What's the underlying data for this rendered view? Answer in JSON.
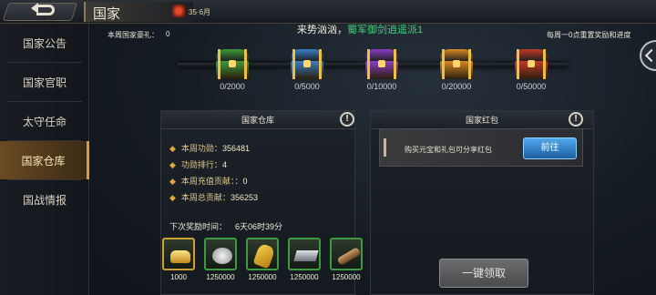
{
  "header": {
    "title": "国家",
    "player_level": "35·6月"
  },
  "sidebar": {
    "items": [
      {
        "label": "国家公告"
      },
      {
        "label": "国家官职"
      },
      {
        "label": "太守任命"
      },
      {
        "label": "国家仓库",
        "active": true
      },
      {
        "label": "国战情报"
      }
    ]
  },
  "top": {
    "gift_label": "本周国家豪礼：",
    "gift_value": "0",
    "marquee_prefix": "来势汹汹，",
    "marquee_highlight": "蜀军御剑逍遥派1",
    "reset_note": "每周一0点重置奖励和进度"
  },
  "chests": [
    {
      "label": "0/2000",
      "color": "#3f9a3a"
    },
    {
      "label": "0/5000",
      "color": "#3a7fc8"
    },
    {
      "label": "0/10000",
      "color": "#8a3ec2"
    },
    {
      "label": "0/20000",
      "color": "#d88a24"
    },
    {
      "label": "0/50000",
      "color": "#c23a2a"
    }
  ],
  "warehouse": {
    "title": "国家仓库",
    "stats": [
      {
        "label": "本周功勋：",
        "value": "356481"
      },
      {
        "label": "功勋排行：",
        "value": "4"
      },
      {
        "label": "本周充值贡献：：",
        "value": "0"
      },
      {
        "label": "本周总贡献：",
        "value": "356253"
      }
    ],
    "countdown_label": "下次奖励时间：",
    "countdown_value": "6天06时39分",
    "items": [
      {
        "qty": "1000",
        "icon": "gold-ingot-icon",
        "frame": "#c9a233"
      },
      {
        "qty": "1250000",
        "icon": "silver-coin-icon",
        "frame": "#3e9a3e"
      },
      {
        "qty": "1250000",
        "icon": "grain-icon",
        "frame": "#3e9a3e"
      },
      {
        "qty": "1250000",
        "icon": "iron-bar-icon",
        "frame": "#3e9a3e"
      },
      {
        "qty": "1250000",
        "icon": "wood-icon",
        "frame": "#3e9a3e"
      }
    ]
  },
  "redpack": {
    "title": "国家红包",
    "text": "购买元宝和礼包可分享红包",
    "goto_label": "前往"
  },
  "claim_label": "一键领取",
  "info_glyph": "!"
}
